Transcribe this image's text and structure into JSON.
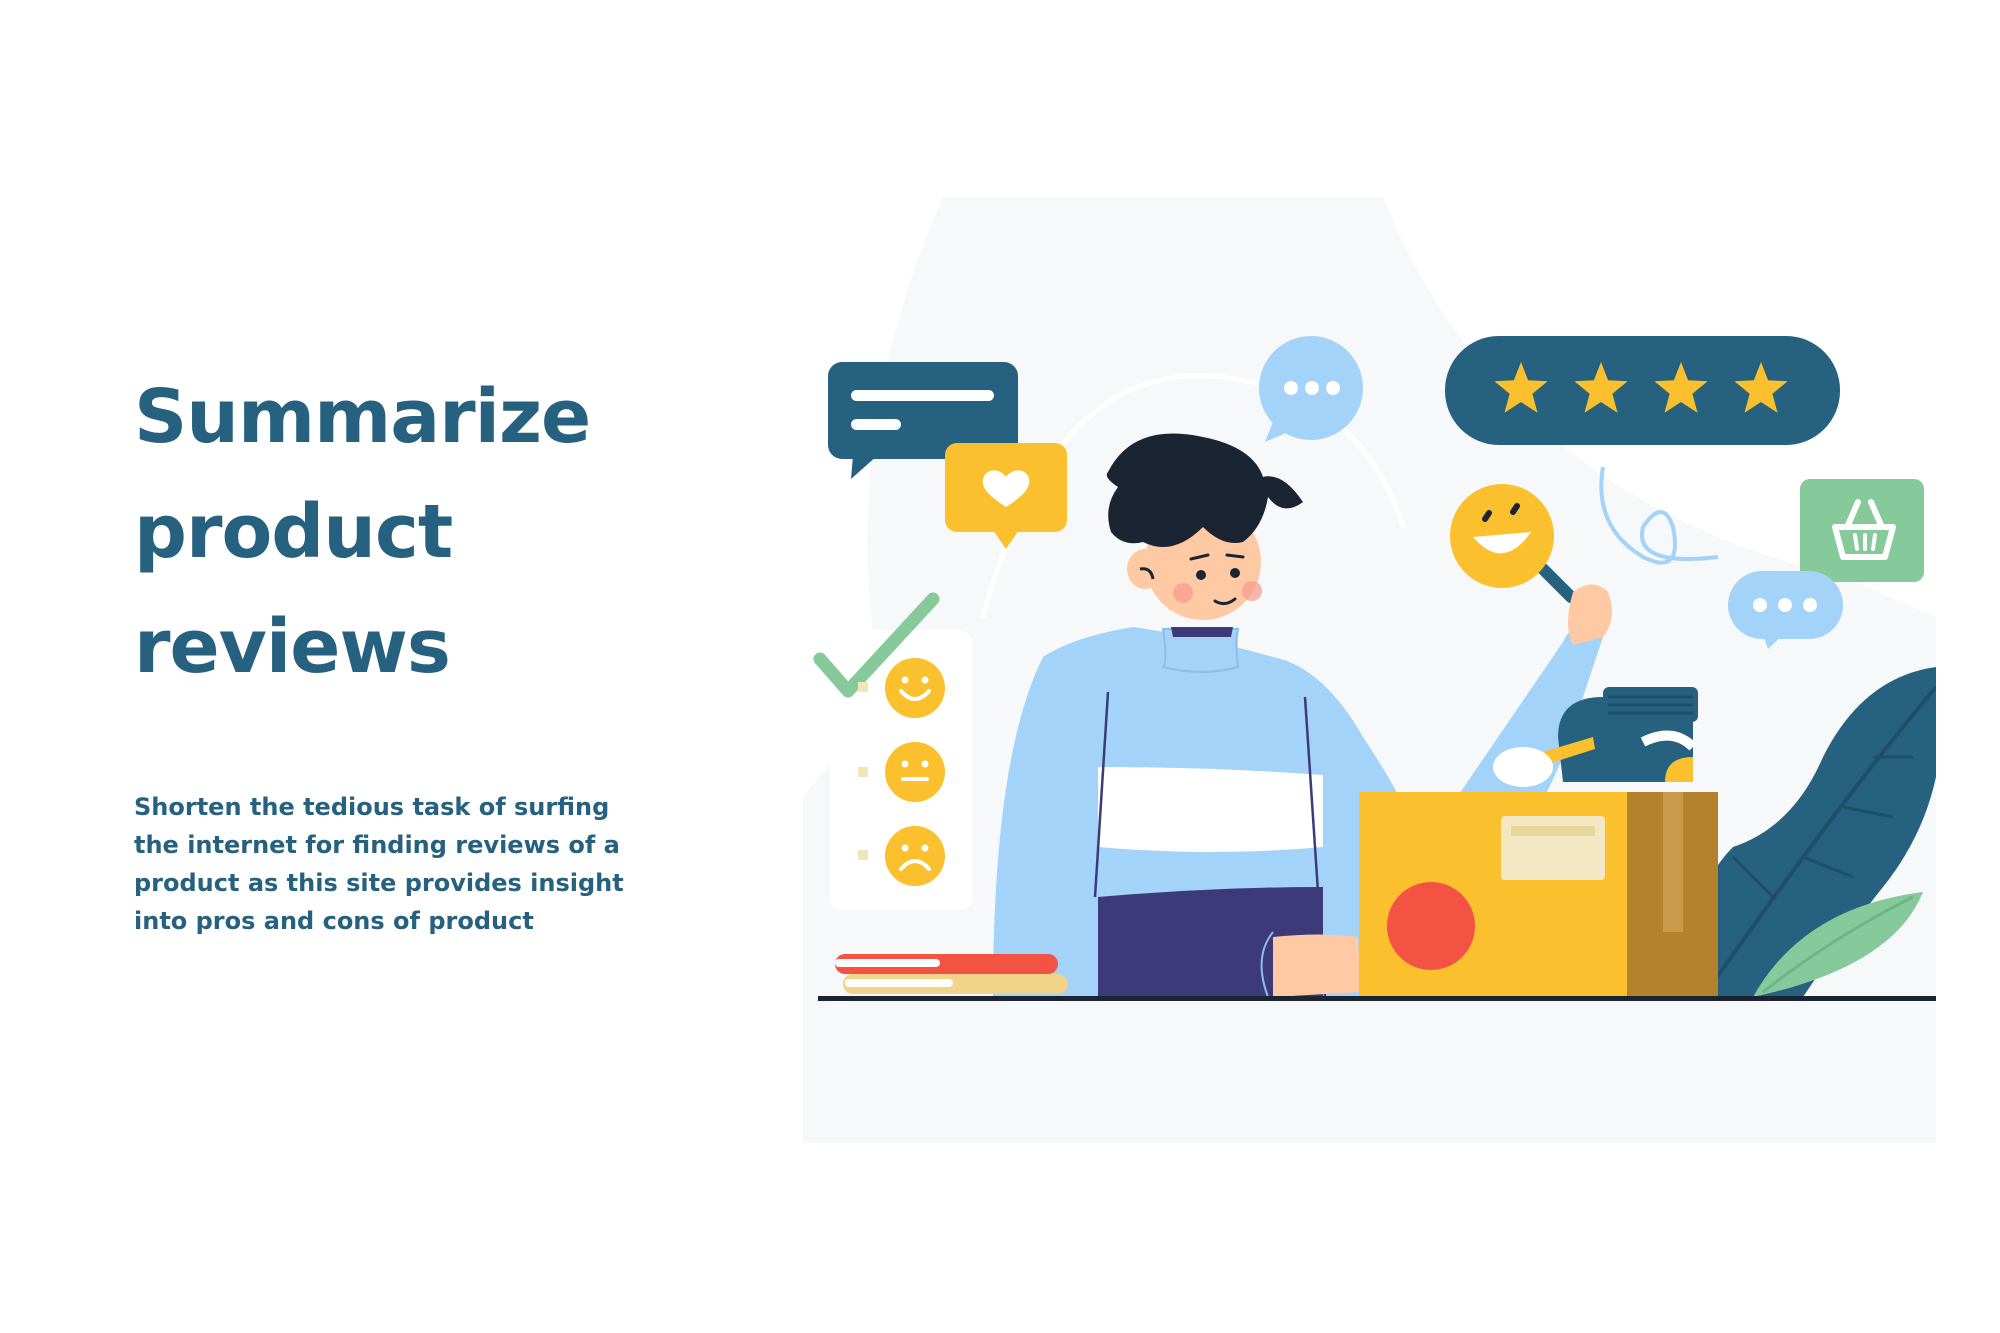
{
  "hero": {
    "title_lines": [
      "Summarize",
      "product",
      "reviews"
    ],
    "description": "Shorten the tedious task of surfing the internet for finding reviews of a product as this site provides insight into pros and cons of product"
  },
  "illustration": {
    "star_rating": 4,
    "colors": {
      "brand_blue": "#276180",
      "accent_yellow": "#fbc02d",
      "light_blue": "#a3d3f9",
      "green": "#86c99b",
      "red": "#f25343"
    }
  }
}
